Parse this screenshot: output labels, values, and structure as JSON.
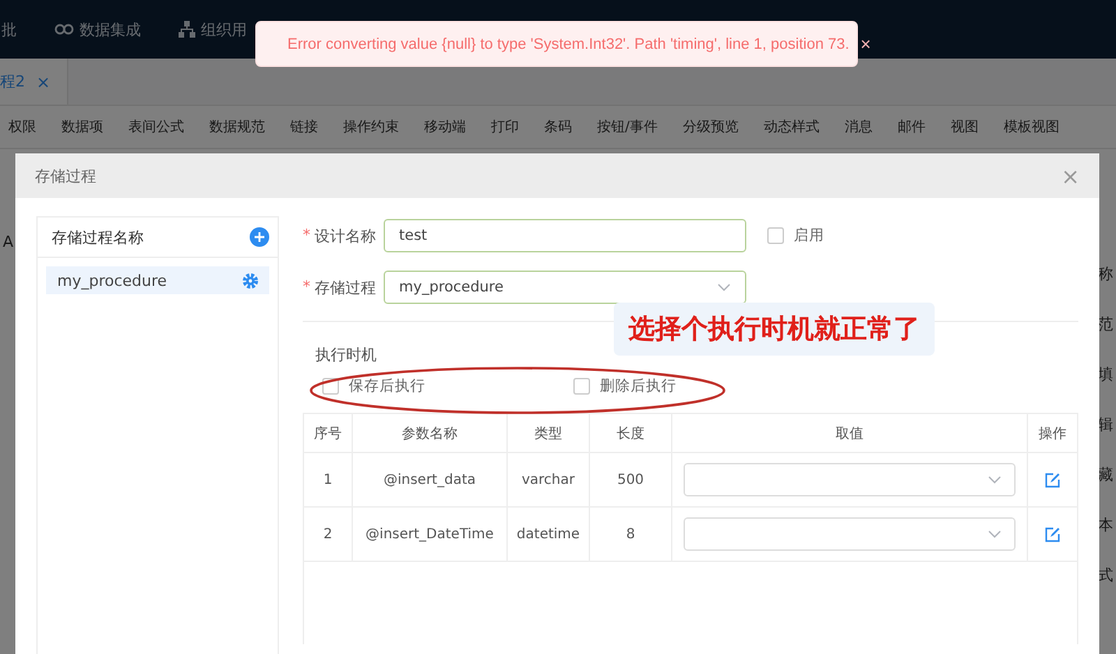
{
  "nav": {
    "items": [
      {
        "kind": "plain",
        "label": "批"
      },
      {
        "kind": "link",
        "label": "数据集成"
      },
      {
        "kind": "org",
        "label": "组织用"
      }
    ]
  },
  "tabs": [
    {
      "label": "程2",
      "selected": true,
      "close": "×"
    }
  ],
  "toolbar": [
    "权限",
    "数据项",
    "表间公式",
    "数据规范",
    "链接",
    "操作约束",
    "移动端",
    "打印",
    "条码",
    "按钮/事件",
    "分级预览",
    "动态样式",
    "消息",
    "邮件",
    "视图",
    "模板视图"
  ],
  "background": {
    "left_fragments": [
      "A"
    ],
    "right_fragments": [
      "称",
      "范",
      "填",
      "辑",
      "藏",
      "本",
      "式"
    ]
  },
  "toast": {
    "message": "Error converting value {null} to type 'System.Int32'. Path 'timing', line 1, position 73.",
    "close": "×"
  },
  "dialog": {
    "title": "存储过程",
    "close": "×",
    "sidebar": {
      "title": "存储过程名称",
      "items": [
        {
          "label": "my_procedure",
          "selected": true
        }
      ]
    },
    "form": {
      "design_name": {
        "required_mark": "*",
        "label": "设计名称",
        "value": "test"
      },
      "enabled": {
        "label": "启用",
        "checked": false
      },
      "procedure": {
        "required_mark": "*",
        "label": "存储过程",
        "value": "my_procedure"
      },
      "timing": {
        "label": "执行时机",
        "options": [
          {
            "label": "保存后执行",
            "checked": false
          },
          {
            "label": "删除后执行",
            "checked": false
          }
        ]
      }
    },
    "table": {
      "columns": [
        "序号",
        "参数名称",
        "类型",
        "长度",
        "取值",
        "操作"
      ],
      "rows": [
        {
          "cells": [
            "1",
            "@insert_data",
            "varchar",
            "500"
          ]
        },
        {
          "cells": [
            "2",
            "@insert_DateTime",
            "datetime",
            "8"
          ]
        }
      ]
    }
  },
  "annotation": {
    "text": "选择个执行时机就正常了"
  }
}
